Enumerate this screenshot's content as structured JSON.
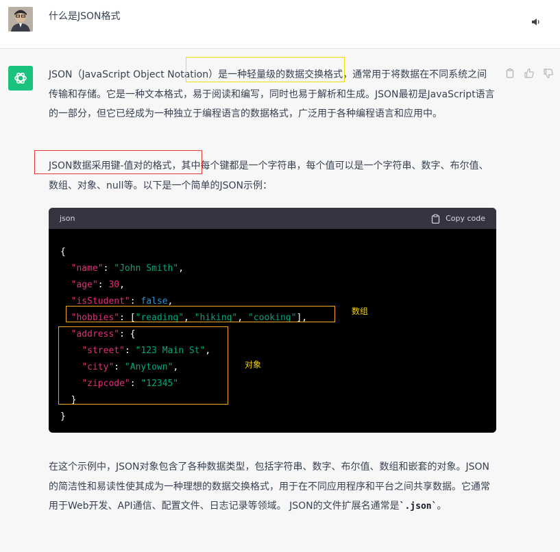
{
  "user": {
    "message": "什么是JSON格式"
  },
  "assistant": {
    "paragraph1": "JSON（JavaScript Object Notation）是一种轻量级的数据交换格式，通常用于将数据在不同系统之间传输和存储。它是一种文本格式，易于阅读和编写，同时也易于解析和生成。JSON最初是JavaScript语言的一部分，但它已经成为一种独立于编程语言的数据格式，广泛用于各种编程语言和应用中。",
    "paragraph2": "JSON数据采用键-值对的格式，其中每个键都是一个字符串，每个值可以是一个字符串、数字、布尔值、数组、对象、null等。以下是一个简单的JSON示例：",
    "paragraph3_prefix": "在这个示例中，JSON对象包含了各种数据类型，包括字符串、数字、布尔值、数组和嵌套的对象。JSON的简洁性和易读性使其成为一种理想的数据交换格式，用于在不同应用程序和平台之间共享数据。它通常用于Web开发、API通信、配置文件、日志记录等领域。 JSON的文件扩展名通常是",
    "paragraph3_code": "`.json`",
    "paragraph3_suffix": "。"
  },
  "code_block": {
    "language": "json",
    "copy_label": "Copy code"
  },
  "annotations": {
    "array_label": "数组",
    "object_label": "对象"
  },
  "icons": {
    "speaker": "speaker-icon",
    "chatgpt": "chatgpt-logo-icon",
    "clipboard": "clipboard-icon",
    "thumbs_up": "thumbs-up-icon",
    "thumbs_down": "thumbs-down-icon"
  },
  "colors": {
    "assistant_bg": "#f7f7f8",
    "brand_green": "#19c37d",
    "code_bg": "#000000",
    "code_header": "#343541",
    "json_key": "#df3079",
    "json_string": "#00a67d",
    "json_bool": "#2e95d3"
  }
}
